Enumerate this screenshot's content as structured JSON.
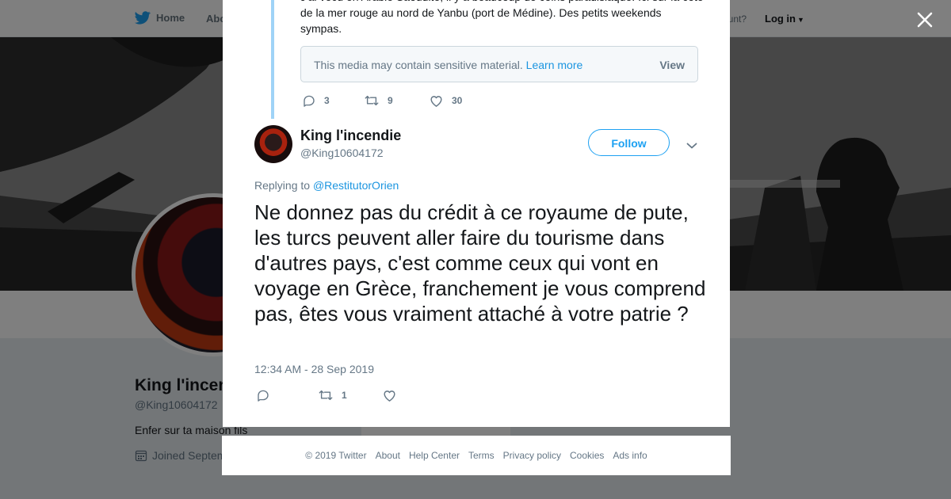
{
  "nav": {
    "home_label": "Home",
    "about_label": "Abo",
    "account_label": "ccount?",
    "login_label": "Log in"
  },
  "profile": {
    "name": "King l'incen",
    "handle": "@King10604172",
    "bio": "Enfer sur ta maison fils",
    "joined": "Joined Septem",
    "card_text": "Ads info"
  },
  "modal": {
    "parent_text": "J'ai vécu en Arabie Saoudite, il y a beaucoup de coins paradisiaque. Ici sur la côte de la mer rouge au nord de Yanbu (port de Médine). Des petits weekends sympas.",
    "sensitive_text": "This media may contain sensitive material.",
    "learn_more": "Learn more",
    "view_label": "View",
    "parent_actions": {
      "replies": "3",
      "retweets": "9",
      "likes": "30"
    },
    "author_name": "King l'incendie",
    "author_handle": "@King10604172",
    "follow_label": "Follow",
    "replying_prefix": "Replying to",
    "replying_handle": "@RestitutorOrien",
    "tweet_text": "Ne donnez pas du crédit à ce royaume de pute, les turcs peuvent aller faire du tourisme dans d'autres pays, c'est comme ceux qui vont en voyage en Grèce, franchement je vous comprend pas, êtes vous vraiment attaché à votre patrie ?",
    "timestamp": "12:34 AM - 28 Sep 2019",
    "actions": {
      "replies": "",
      "retweets": "1",
      "likes": ""
    }
  },
  "footer": {
    "items": [
      "© 2019 Twitter",
      "About",
      "Help Center",
      "Terms",
      "Privacy policy",
      "Cookies",
      "Ads info"
    ]
  },
  "colors": {
    "brand": "#1da1f2",
    "link": "#1b95e0",
    "thread_line": "#9fd3f7",
    "text": "#14171a",
    "secondary": "#657786"
  },
  "icons": [
    "twitter-bird-icon",
    "close-icon",
    "reply-icon",
    "retweet-icon",
    "like-icon",
    "chevron-down-icon",
    "calendar-icon"
  ]
}
